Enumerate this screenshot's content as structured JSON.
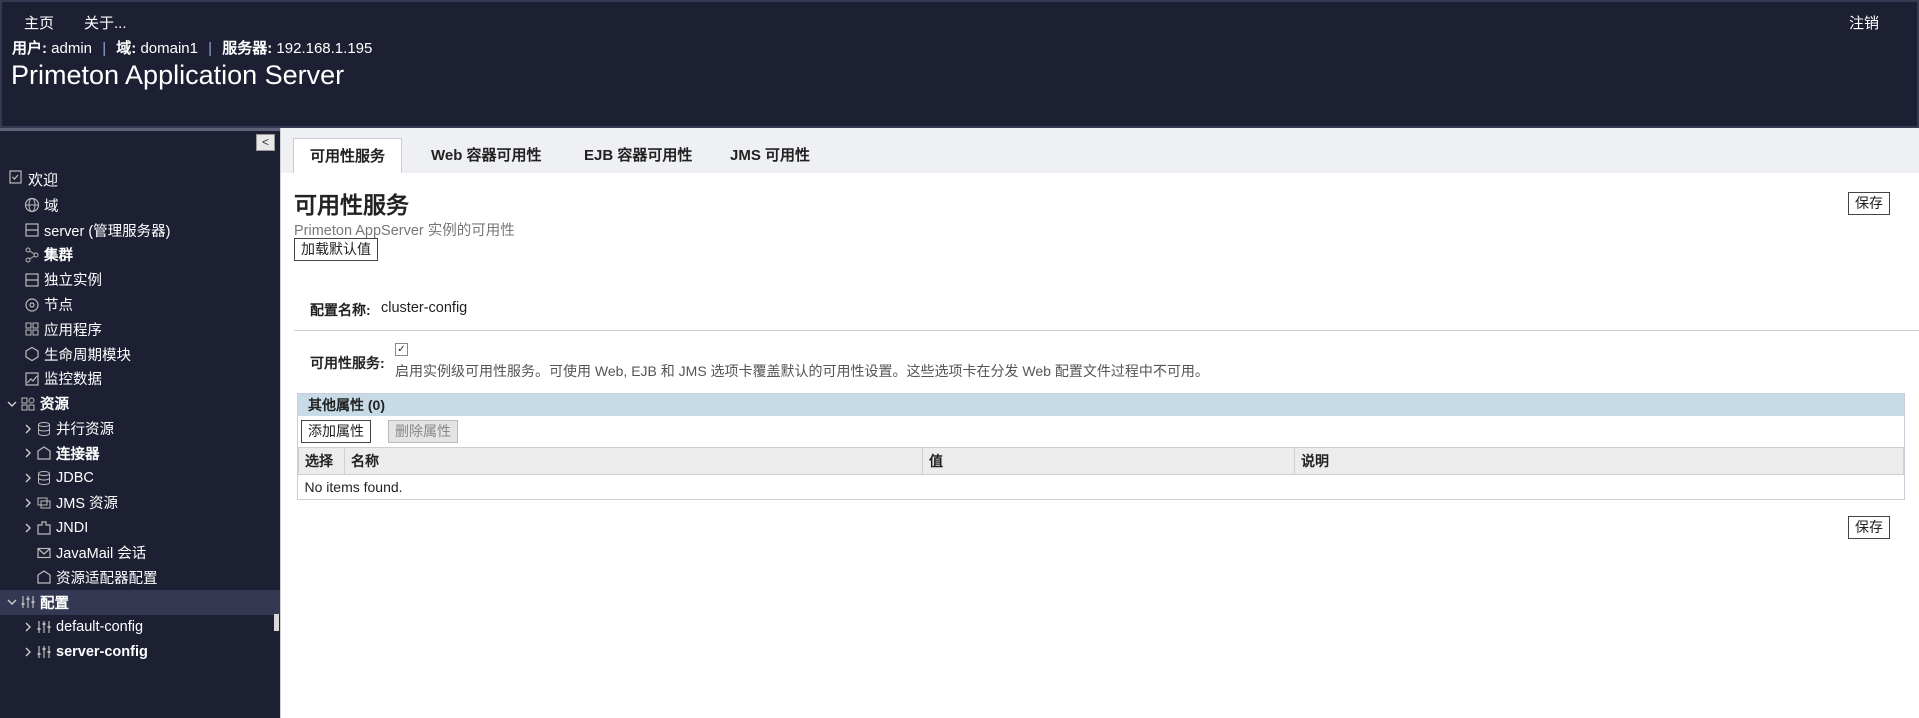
{
  "header": {
    "nav": [
      "主页",
      "关于..."
    ],
    "logout_label": "注销",
    "user_label": "用户:",
    "user_value": "admin",
    "domain_label": "域:",
    "domain_value": "domain1",
    "server_label": "服务器:",
    "server_value": "192.168.1.195",
    "separator": "|",
    "app_title": "Primeton Application Server"
  },
  "sidebar": {
    "collapse_glyph": "<",
    "welcome_label": "欢迎",
    "items": [
      {
        "label": "域",
        "icon": "globe-icon"
      },
      {
        "label": "server (管理服务器)",
        "icon": "server-icon"
      },
      {
        "label": "集群",
        "icon": "cluster-icon"
      },
      {
        "label": "独立实例",
        "icon": "instance-icon"
      },
      {
        "label": "节点",
        "icon": "node-icon"
      },
      {
        "label": "应用程序",
        "icon": "apps-icon"
      },
      {
        "label": "生命周期模块",
        "icon": "lifecycle-icon"
      },
      {
        "label": "监控数据",
        "icon": "monitor-icon"
      },
      {
        "label": "资源",
        "icon": "resources-icon"
      },
      {
        "label": "并行资源",
        "icon": "database-icon"
      },
      {
        "label": "连接器",
        "icon": "connector-icon"
      },
      {
        "label": "JDBC",
        "icon": "database-icon"
      },
      {
        "label": "JMS 资源",
        "icon": "jms-icon"
      },
      {
        "label": "JNDI",
        "icon": "jndi-icon"
      },
      {
        "label": "JavaMail 会话",
        "icon": "mail-icon"
      },
      {
        "label": "资源适配器配置",
        "icon": "adapter-icon"
      },
      {
        "label": "配置",
        "icon": "config-icon"
      },
      {
        "label": "default-config",
        "icon": "config-icon"
      },
      {
        "label": "server-config",
        "icon": "config-icon"
      }
    ]
  },
  "tabs": [
    "可用性服务",
    "Web 容器可用性",
    "EJB 容器可用性",
    "JMS 可用性"
  ],
  "main": {
    "title": "可用性服务",
    "subtitle": "Primeton AppServer 实例的可用性",
    "save_label": "保存",
    "load_defaults_label": "加载默认值",
    "config_name_label": "配置名称:",
    "config_name_value": "cluster-config",
    "availability_label": "可用性服务:",
    "availability_checked": true,
    "availability_help": "启用实例级可用性服务。可使用 Web, EJB 和 JMS 选项卡覆盖默认的可用性设置。这些选项卡在分发 Web 配置文件过程中不可用。"
  },
  "properties": {
    "header": "其他属性 (0)",
    "add_label": "添加属性",
    "delete_label": "删除属性",
    "columns": [
      "选择",
      "名称",
      "值",
      "说明"
    ],
    "empty_text": "No items found."
  },
  "colors": {
    "header_bg": "#1d1f33",
    "sidebar_bg": "#1d1f33",
    "selected_bg": "#353852",
    "table_header_bg": "#c6dbe6"
  }
}
